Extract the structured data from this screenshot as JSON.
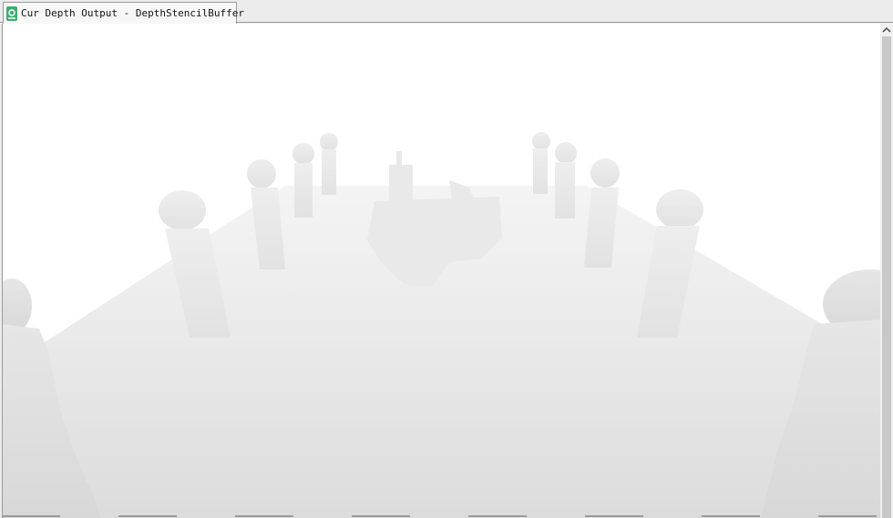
{
  "tab": {
    "title": "Cur Depth Output - DepthStencilBuffer",
    "icon": "texture-viewer-icon"
  },
  "viewport": {
    "content": "depth-buffer-visualization"
  },
  "colors": {
    "tab_icon": "#3fae72",
    "background": "#ffffff"
  }
}
